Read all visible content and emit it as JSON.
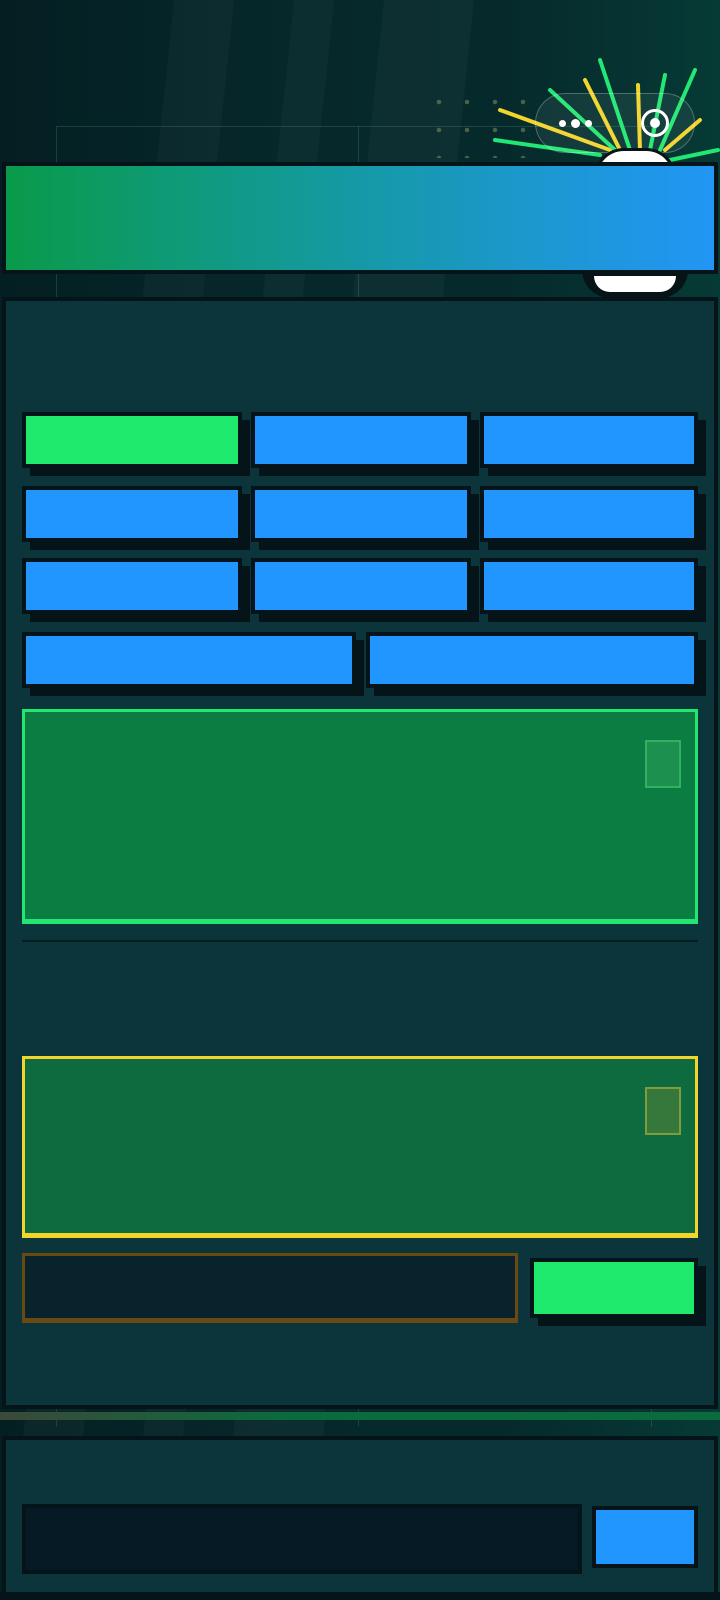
{
  "header": {
    "title": ""
  },
  "capsule": {
    "more_icon": "more-dots-icon",
    "close_icon": "close-circle-icon"
  },
  "panel": {
    "title": "",
    "options": [
      {
        "label": "",
        "active": true
      },
      {
        "label": "",
        "active": false
      },
      {
        "label": "",
        "active": false
      },
      {
        "label": "",
        "active": false
      },
      {
        "label": "",
        "active": false
      },
      {
        "label": "",
        "active": false
      },
      {
        "label": "",
        "active": false
      },
      {
        "label": "",
        "active": false
      },
      {
        "label": "",
        "active": false
      },
      {
        "label": "",
        "active": false
      },
      {
        "label": "",
        "active": false
      }
    ],
    "primary_card": {
      "text": "",
      "copy_icon": "copy-icon"
    },
    "section_label": "",
    "secondary_card": {
      "text": "",
      "copy_icon": "copy-icon"
    },
    "input": {
      "value": "",
      "placeholder": ""
    },
    "confirm_label": ""
  },
  "footer": {
    "input": {
      "value": "",
      "placeholder": ""
    },
    "send_label": ""
  },
  "colors": {
    "background": "#062629",
    "panel": "#0c343b",
    "blue_button": "#2196ff",
    "green_active": "#20ea6e",
    "green_card": "#0c7d42",
    "green_card_border": "#22e772",
    "yellow_card_border": "#f2d52a",
    "brown_input_border": "#6a4a12"
  }
}
